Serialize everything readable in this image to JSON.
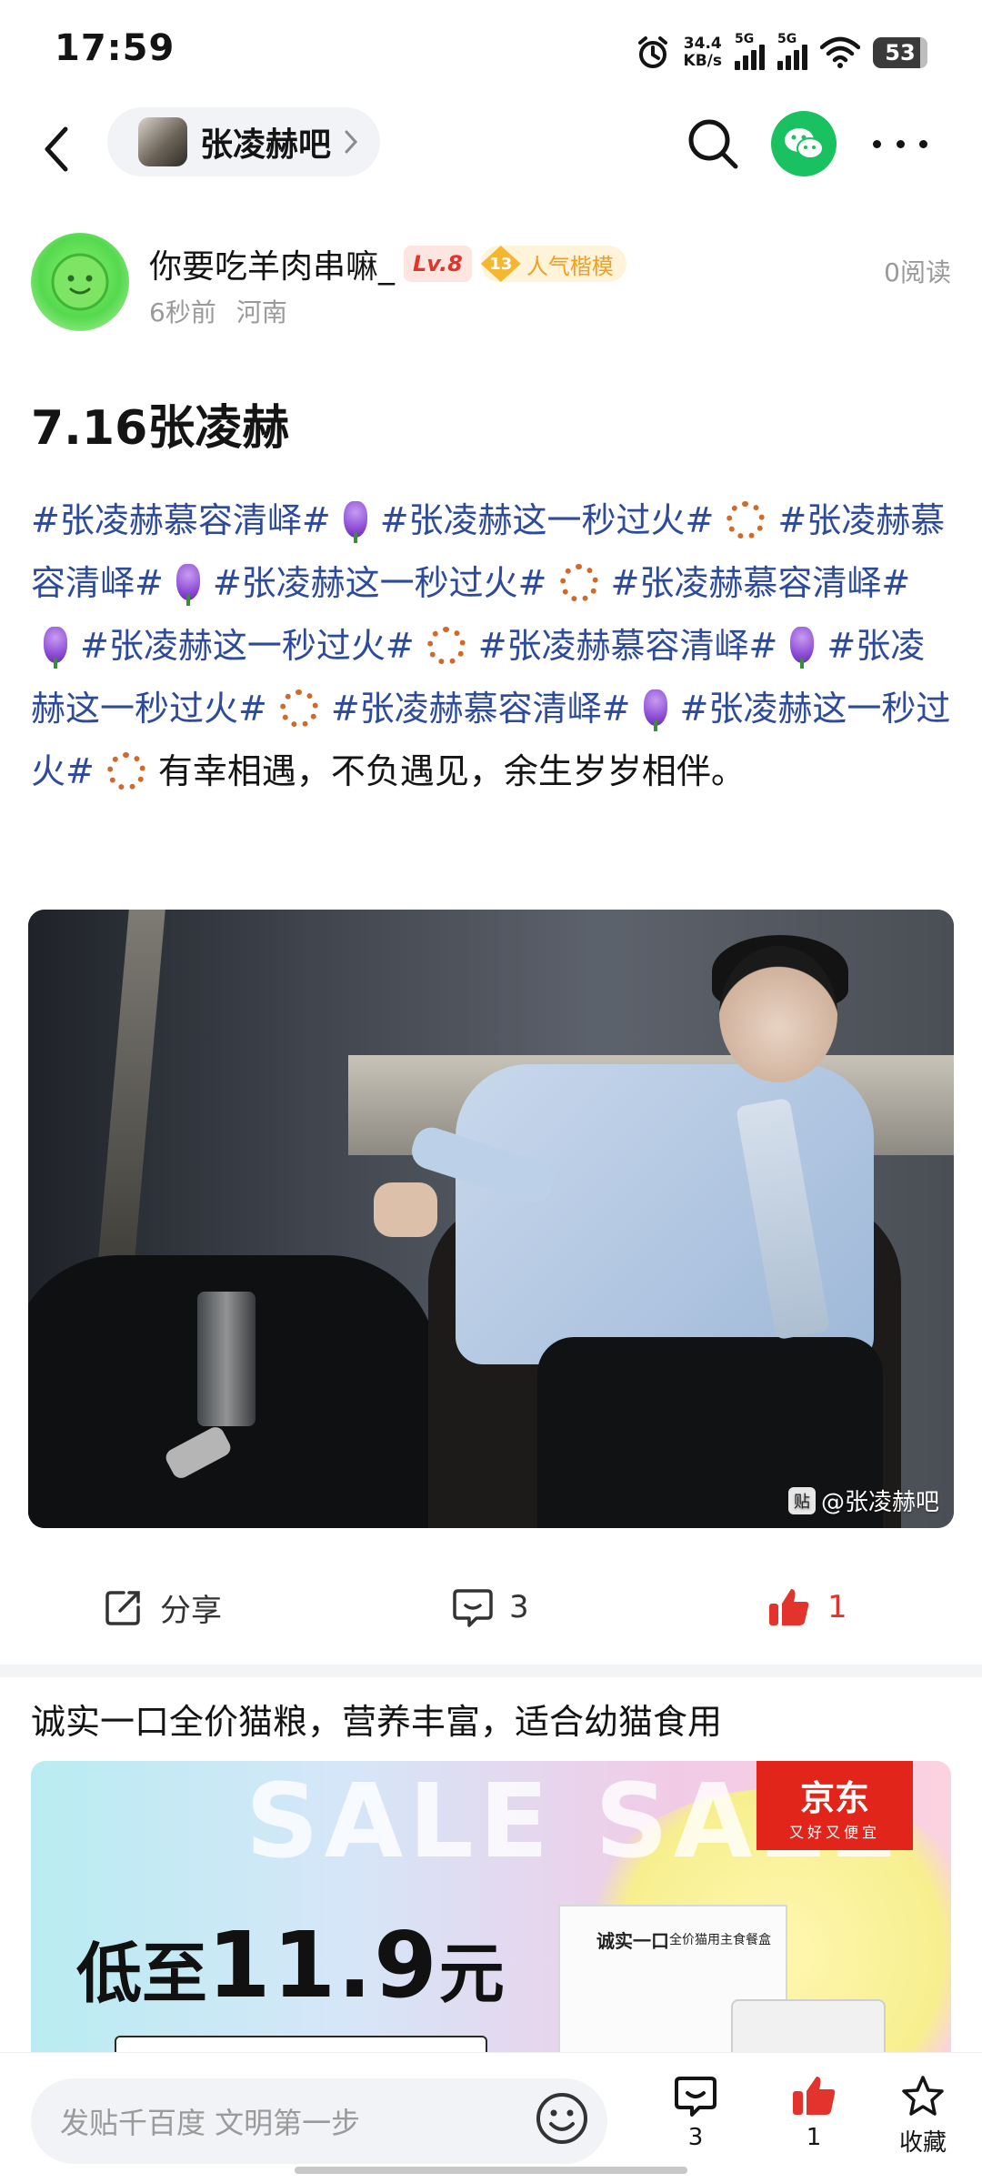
{
  "status_bar": {
    "time": "17:59",
    "speed_value": "34.4",
    "speed_unit": "KB/s",
    "sim1": "5G",
    "sim2": "5G",
    "battery": "53"
  },
  "header": {
    "forum_name": "张凌赫吧",
    "icons": [
      "back-icon",
      "chevron-right-icon",
      "search-icon",
      "wechat-icon",
      "more-icon"
    ],
    "wechat_color": "#19c160"
  },
  "author": {
    "name": "你要吃羊肉串嘛_",
    "level": "Lv.8",
    "title_level": "13",
    "title_name": "人气楷模",
    "time": "6秒前",
    "location": "河南",
    "read_count": "0阅读"
  },
  "post": {
    "title": "7.16张凌赫",
    "tag_a": "#张凌赫慕容清峄#",
    "tag_b": "#张凌赫这一秒过火#",
    "tail": "有幸相遇，不负遇见，余生岁岁相伴。",
    "tag_color": "#2d4a9b",
    "watermark": "@张凌赫吧"
  },
  "actions": {
    "share_label": "分享",
    "comment_count": "3",
    "like_count": "1",
    "like_color": "#e2342c"
  },
  "ad": {
    "title": "诚实一口全价猫粮，营养丰富，适合幼猫食用",
    "sale_text": "SALE  SALE",
    "jd_name": "京东",
    "jd_slogan": "又好又便宜",
    "price_prefix": "低至",
    "price_value": "11.9",
    "price_unit": "元",
    "box_brand": "诚实一口",
    "box_desc": "全价猫用主食餐盒",
    "jd_color": "#e1251b"
  },
  "bottom_bar": {
    "input_placeholder": "发贴千百度 文明第一步",
    "comment_count": "3",
    "like_count": "1",
    "favorite_label": "收藏"
  }
}
